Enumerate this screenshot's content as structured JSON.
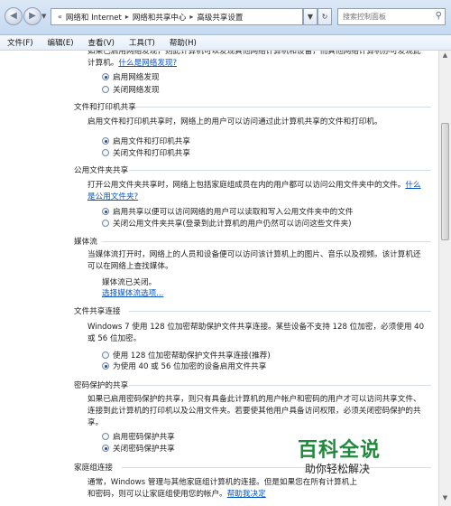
{
  "addressbar": {
    "back": "◀",
    "forward": "▶",
    "breadcrumbs": [
      "«",
      "网络和 Internet",
      "网络和共享中心",
      "高级共享设置"
    ],
    "search_placeholder": "搜索控制面板"
  },
  "menu": [
    "文件(F)",
    "编辑(E)",
    "查看(V)",
    "工具(T)",
    "帮助(H)"
  ],
  "network_discovery": {
    "desc_line1": "如果已启用网络发现，则此计算机可以发现其他网络计算机和设备，而其他网络计算机亦可发现此",
    "desc_line2": "计算机。",
    "link": "什么是网络发现?",
    "options": [
      "启用网络发现",
      "关闭网络发现"
    ]
  },
  "file_printer": {
    "title": "文件和打印机共享",
    "desc": "启用文件和打印机共享时，网络上的用户可以访问通过此计算机共享的文件和打印机。",
    "options": [
      "启用文件和打印机共享",
      "关闭文件和打印机共享"
    ]
  },
  "public_folder": {
    "title": "公用文件夹共享",
    "desc_line1": "打开公用文件夹共享时，网络上包括家庭组成员在内的用户都可以访问公用文件夹中的文件。",
    "link1": "什么",
    "link2": "是公用文件夹?",
    "options": [
      "启用共享以便可以访问网络的用户可以读取和写入公用文件夹中的文件",
      "关闭公用文件夹共享(登录到此计算机的用户仍然可以访问这些文件夹)"
    ]
  },
  "media_streaming": {
    "title": "媒体流",
    "desc_line1": "当媒体流打开时，网络上的人员和设备便可以访问该计算机上的图片、音乐以及视频。该计算机还",
    "desc_line2": "可以在网络上查找媒体。",
    "status": "媒体流已关闭。",
    "link": "选择媒体流选项..."
  },
  "file_sharing_conn": {
    "title": "文件共享连接",
    "desc_line1": "Windows 7 使用 128 位加密帮助保护文件共享连接。某些设备不支持 128 位加密，必须使用 40",
    "desc_line2": "或 56 位加密。",
    "options": [
      "使用 128 位加密帮助保护文件共享连接(推荐)",
      "为使用 40 或 56 位加密的设备启用文件共享"
    ]
  },
  "password_sharing": {
    "title": "密码保护的共享",
    "desc_line1": "如果已启用密码保护的共享，则只有具备此计算机的用户帐户和密码的用户才可以访问共享文件、",
    "desc_line2": "连接到此计算机的打印机以及公用文件夹。若要使其他用户具备访问权限，必须关闭密码保护的共",
    "desc_line3": "享。",
    "options": [
      "启用密码保护共享",
      "关闭密码保护共享"
    ]
  },
  "homegroup": {
    "title": "家庭组连接",
    "desc_line1": "通常，Windows 管理与其他家庭组计算机的连接。但是如果您在所有计算机上",
    "desc_line2": "和密码，则可以让家庭组使用您的帐户。",
    "link": "帮助我决定"
  },
  "watermark": {
    "main": "百科全说",
    "sub": "助你轻松解决"
  }
}
